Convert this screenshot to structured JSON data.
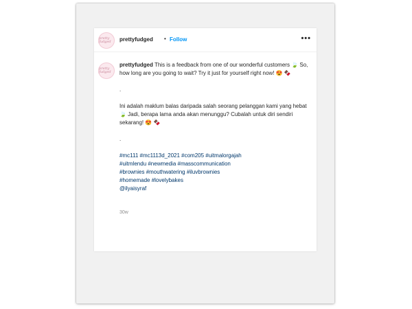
{
  "post": {
    "username": "prettyfudged",
    "separator": "•",
    "follow_label": "Follow",
    "more_label": "•••",
    "avatar_text": "pretty fudged",
    "caption": {
      "en": "This is a feedback from one of our wonderful customers 🍃 So, how long are you going to wait? Try it just for yourself right now! 😍 🍫",
      "dot1": ".",
      "ms": "Ini adalah maklum balas daripada salah seorang pelanggan kami yang hebat 🍃 Jadi, berapa lama anda akan menunggu? Cubalah untuk diri sendiri sekarang! 😍 🍫",
      "dot2": ".",
      "tags": [
        "#mc111 #mc1113d_2021 #com205 #uitmalorgajah",
        "#uitmlendu #newmedia #masscommunication",
        "#brownies #mouthwatering #iluvbrownies",
        "#homemade #lovelybakes",
        "@ilyaisyraf"
      ]
    },
    "timestamp": "30w"
  }
}
